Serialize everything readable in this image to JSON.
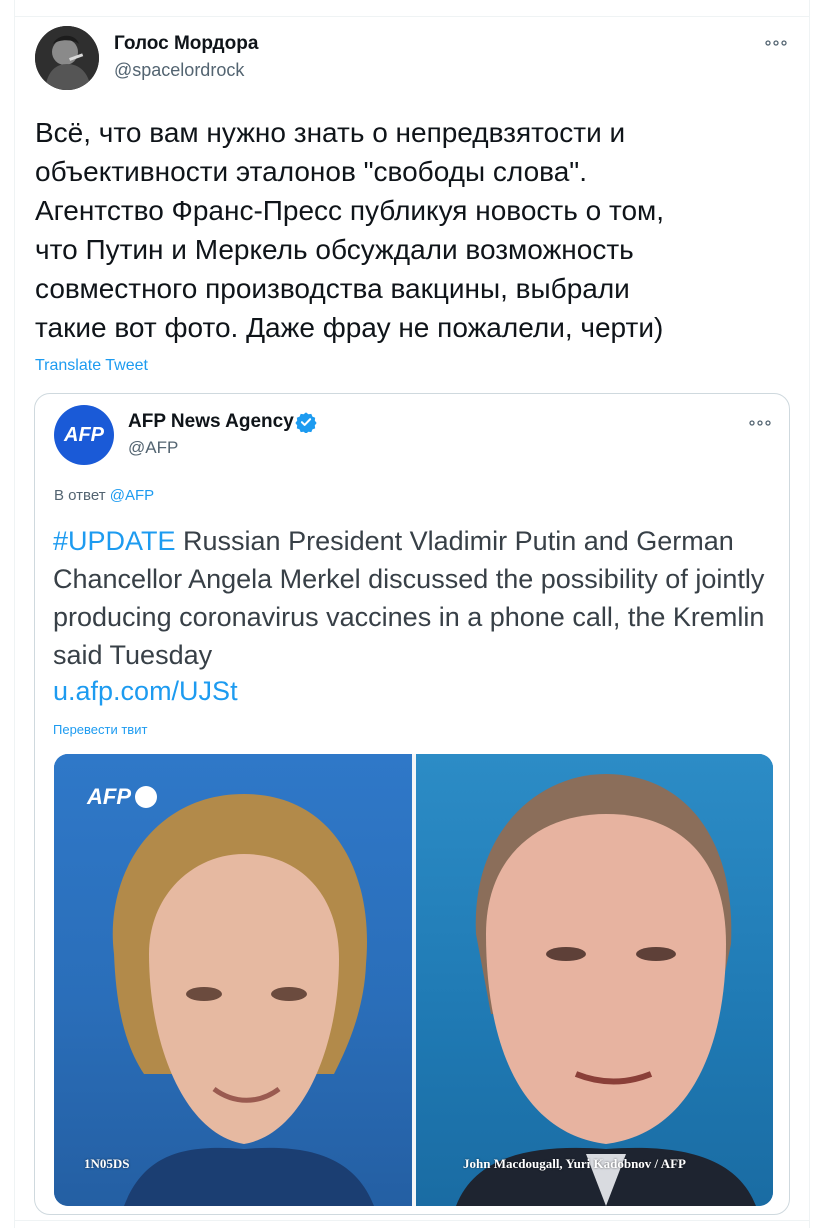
{
  "tweet": {
    "author_name": "Голос Мордора",
    "author_handle": "@spacelordrock",
    "avatar_icon": "user-avatar-photo",
    "text": "Всё, что вам нужно знать о непредвзятости и\nобъективности эталонов \"свободы слова\".\nАгентство Франс-Пресс публикуя новость о том,\nчто Путин и Меркель обсуждали возможность\nсовместного производства вакцины, выбрали\nтакие вот фото. Даже фрау не пожалели, черти)",
    "translate_label": "Translate Tweet",
    "more_icon": "more-options-icon"
  },
  "quoted_tweet": {
    "author_name": "AFP News Agency",
    "author_handle": "@AFP",
    "avatar_text": "AFP",
    "verified_icon": "verified-badge-icon",
    "reply_prefix": "В ответ",
    "reply_mention": "@AFP",
    "hashtag": "#UPDATE",
    "text": " Russian President Vladimir Putin and German Chancellor Angela Merkel discussed the possibility of jointly producing coronavirus vaccines in a phone call, the Kremlin said Tuesday",
    "link": "u.afp.com/UJSt",
    "translate_label": "Перевести твит",
    "media": {
      "logo_text": "AFP",
      "credit_left": "1N05DS",
      "credit_right": "John Macdougall, Yuri Kadobnov / AFP"
    }
  },
  "colors": {
    "link_blue": "#1d9bf0",
    "afp_blue": "#1a5ad7",
    "text_primary": "#0f1419",
    "text_secondary": "#536471"
  }
}
